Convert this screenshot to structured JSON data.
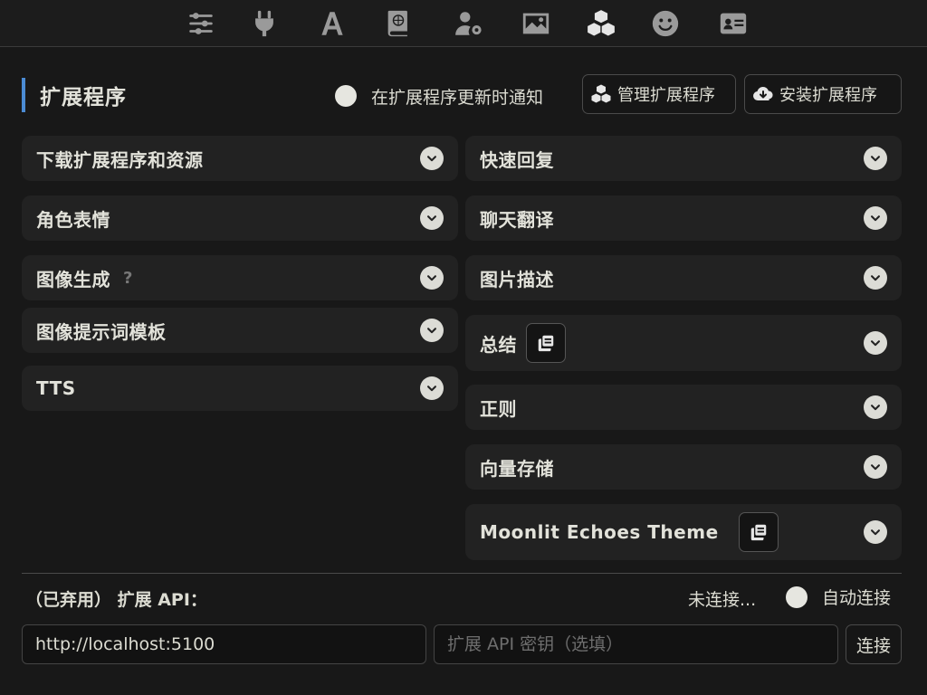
{
  "topbar": {
    "icons": [
      {
        "name": "sliders-icon"
      },
      {
        "name": "plug-icon"
      },
      {
        "name": "font-icon"
      },
      {
        "name": "book-globe-icon"
      },
      {
        "name": "user-gear-icon"
      },
      {
        "name": "image-icon"
      },
      {
        "name": "cubes-icon"
      },
      {
        "name": "smile-icon"
      },
      {
        "name": "id-card-icon"
      }
    ],
    "active_icon": "cubes-icon"
  },
  "header": {
    "title": "扩展程序",
    "notify_label": "在扩展程序更新时通知",
    "manage_button": "管理扩展程序",
    "install_button": "安装扩展程序"
  },
  "left_drawers": [
    {
      "label": "下载扩展程序和资源"
    },
    {
      "label": "角色表情"
    },
    {
      "label": "图像生成",
      "hint": "?"
    },
    {
      "label": "图像提示词模板"
    },
    {
      "label": "TTS"
    }
  ],
  "right_drawers": [
    {
      "label": "快速回复"
    },
    {
      "label": "聊天翻译"
    },
    {
      "label": "图片描述"
    },
    {
      "label": "总结"
    },
    {
      "label": "正则"
    },
    {
      "label": "向量存储"
    },
    {
      "label": "Moonlit Echoes Theme"
    }
  ],
  "api": {
    "label": "（已弃用） 扩展 API：",
    "status": "未连接...",
    "autoconnect_label": "自动连接",
    "url_value": "http://localhost:5100",
    "key_placeholder": "扩展 API 密钥（选填）",
    "connect_button": "连接"
  },
  "colors": {
    "accent": "#4b8bd4",
    "background": "#181818",
    "drawer": "#222222"
  }
}
